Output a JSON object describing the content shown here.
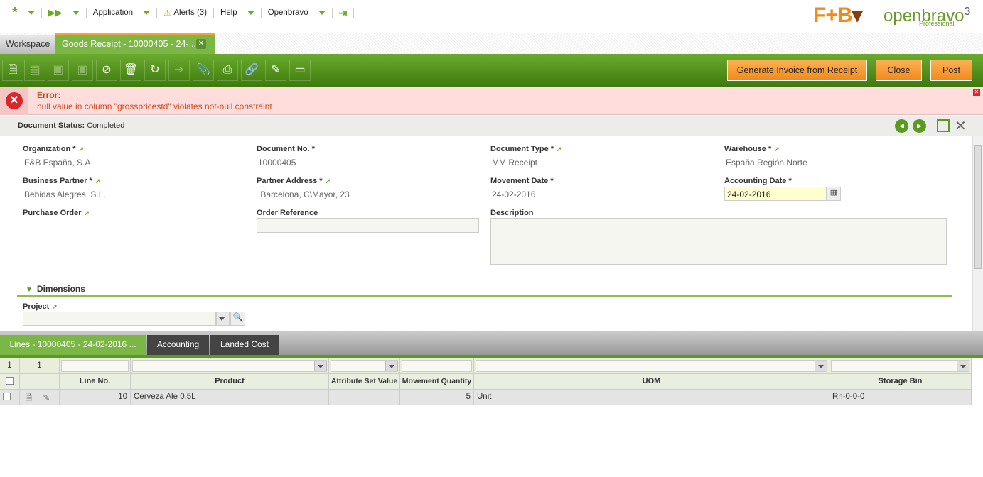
{
  "topnav": {
    "application": "Application",
    "alerts": "Alerts (3)",
    "help": "Help",
    "openbravo": "Openbravo"
  },
  "logos": {
    "fb": "F&B",
    "openbravo": "openbravo",
    "edition": "Professional",
    "version": "3"
  },
  "tabs": {
    "workspace": "Workspace",
    "active": "Goods Receipt - 10000405 - 24-..."
  },
  "toolbar": {
    "generate_invoice": "Generate Invoice from Receipt",
    "close": "Close",
    "post": "Post"
  },
  "error": {
    "title": "Error:",
    "message": "null value in column \"grosspricestd\" violates not-null constraint"
  },
  "status": {
    "label": "Document Status:",
    "value": "Completed"
  },
  "form": {
    "organization": {
      "label": "Organization *",
      "value": "F&B España, S.A"
    },
    "document_no": {
      "label": "Document No. *",
      "value": "10000405"
    },
    "document_type": {
      "label": "Document Type *",
      "value": "MM Receipt"
    },
    "warehouse": {
      "label": "Warehouse *",
      "value": "España Región Norte"
    },
    "business_partner": {
      "label": "Business Partner *",
      "value": "Bebidas Alegres, S.L."
    },
    "partner_address": {
      "label": "Partner Address *",
      "value": ".Barcelona, C\\Mayor, 23"
    },
    "movement_date": {
      "label": "Movement Date *",
      "value": "24-02-2016"
    },
    "accounting_date": {
      "label": "Accounting Date *",
      "value": "24-02-2016"
    },
    "purchase_order": {
      "label": "Purchase Order"
    },
    "order_reference": {
      "label": "Order Reference"
    },
    "description": {
      "label": "Description"
    },
    "dimensions": "Dimensions",
    "project": {
      "label": "Project"
    }
  },
  "subtabs": {
    "lines": "Lines - 10000405 - 24-02-2016 ...",
    "accounting": "Accounting",
    "landed_cost": "Landed Cost"
  },
  "grid": {
    "counts": [
      "1",
      "1"
    ],
    "headers": [
      "Line No.",
      "Product",
      "Attribute Set Value",
      "Movement Quantity",
      "UOM",
      "Storage Bin"
    ],
    "rows": [
      {
        "line": "10",
        "product": "Cerveza Ale 0,5L",
        "attr": "",
        "qty": "5",
        "uom": "Unit",
        "bin": "Rn-0-0-0"
      }
    ]
  }
}
